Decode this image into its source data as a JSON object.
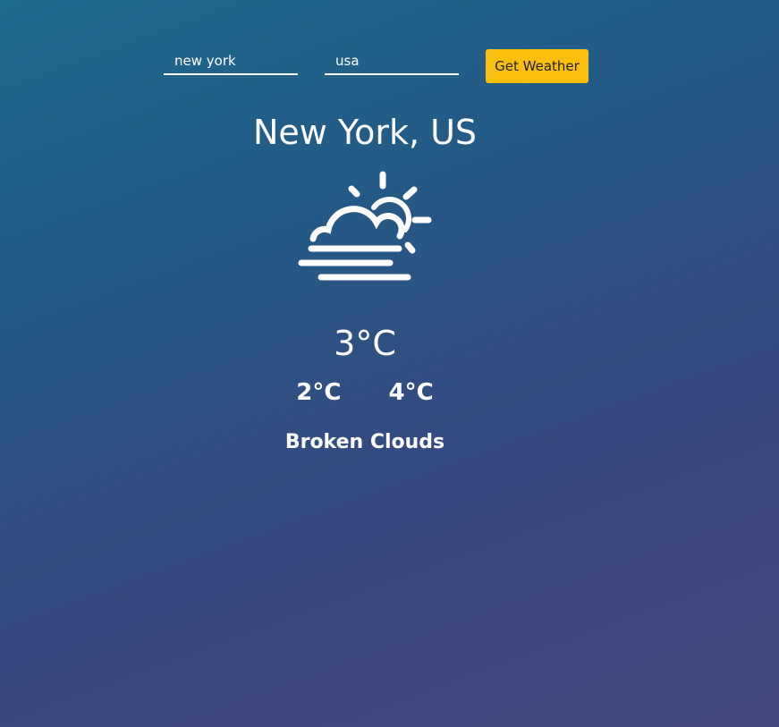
{
  "search": {
    "city_value": "new york",
    "country_value": "usa",
    "button_label": "Get Weather"
  },
  "weather": {
    "location": "New York, US",
    "icon": "partly-cloudy-fog-icon",
    "temperature": "3°C",
    "temp_min": "2°C",
    "temp_max": "4°C",
    "description": "Broken Clouds"
  },
  "colors": {
    "button": "#fbbf0f",
    "text": "#ffffff",
    "bg_top": "#1c6a8c",
    "bg_bottom": "#44497e"
  }
}
